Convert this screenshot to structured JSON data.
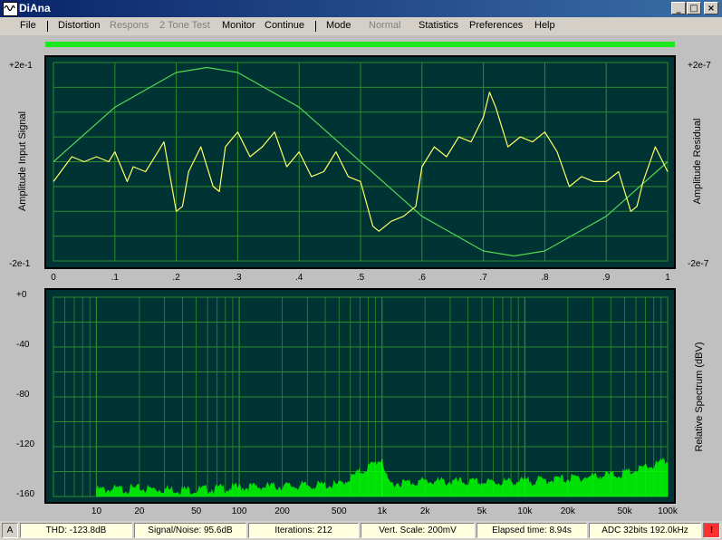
{
  "window": {
    "title": "DiAna"
  },
  "menu": [
    {
      "key": "file",
      "label": "File",
      "enabled": true
    },
    {
      "key": "distortion",
      "label": "Distortion",
      "enabled": true
    },
    {
      "key": "respons",
      "label": "Respons",
      "enabled": false
    },
    {
      "key": "two-tone-test",
      "label": "2 Tone Test",
      "enabled": false
    },
    {
      "key": "monitor",
      "label": "Monitor",
      "enabled": true
    },
    {
      "key": "continue",
      "label": "Continue",
      "enabled": true
    },
    {
      "key": "mode",
      "label": "Mode",
      "enabled": true
    },
    {
      "key": "normal",
      "label": "Normal",
      "enabled": false
    },
    {
      "key": "statistics",
      "label": "Statistics",
      "enabled": true
    },
    {
      "key": "preferences",
      "label": "Preferences",
      "enabled": true
    },
    {
      "key": "help",
      "label": "Help",
      "enabled": true
    }
  ],
  "progress": {
    "fraction": 1.0,
    "color": "#1ee81e"
  },
  "top_plot": {
    "left_axis_title": "Amplitude Input Signal",
    "right_axis_title": "Amplitude Residual",
    "left_top": "+2e-1",
    "left_bottom": "-2e-1",
    "right_top": "+2e-7",
    "right_bottom": "-2e-7",
    "x_ticks": [
      "0",
      ".1",
      ".2",
      ".3",
      ".4",
      ".5",
      ".6",
      ".7",
      ".8",
      ".9",
      "1"
    ]
  },
  "bottom_plot": {
    "right_axis_title": "Relative Spectrum  (dBV)",
    "y_ticks": [
      "+0",
      "-40",
      "-80",
      "-120",
      "-160"
    ],
    "x_ticks": [
      "10",
      "20",
      "50",
      "100",
      "200",
      "500",
      "1k",
      "2k",
      "5k",
      "10k",
      "20k",
      "50k",
      "100k"
    ]
  },
  "chart_data": [
    {
      "type": "line",
      "title": "",
      "xlabel": "",
      "ylabel": "Amplitude Input Signal",
      "xlim": [
        0,
        1
      ],
      "ylim": [
        -0.2,
        0.2
      ],
      "grid": true,
      "series": [
        {
          "name": "",
          "color": "#55d455",
          "x": [
            0,
            0.1,
            0.2,
            0.25,
            0.3,
            0.4,
            0.5,
            0.6,
            0.7,
            0.75,
            0.8,
            0.9,
            1.0
          ],
          "values": [
            0.0,
            0.11,
            0.18,
            0.19,
            0.18,
            0.11,
            0.0,
            -0.11,
            -0.18,
            -0.19,
            -0.18,
            -0.11,
            0.0
          ]
        }
      ]
    },
    {
      "type": "line",
      "title": "",
      "xlabel": "",
      "ylabel": "Amplitude Residual",
      "xlim": [
        0,
        1
      ],
      "ylim": [
        -2e-07,
        2e-07
      ],
      "grid": true,
      "series": [
        {
          "name": "",
          "color": "#ffff66",
          "x": [
            0,
            0.03,
            0.05,
            0.07,
            0.09,
            0.1,
            0.12,
            0.13,
            0.15,
            0.17,
            0.18,
            0.2,
            0.21,
            0.22,
            0.24,
            0.26,
            0.27,
            0.28,
            0.3,
            0.32,
            0.34,
            0.36,
            0.38,
            0.4,
            0.42,
            0.44,
            0.46,
            0.48,
            0.5,
            0.52,
            0.53,
            0.55,
            0.57,
            0.59,
            0.6,
            0.62,
            0.64,
            0.66,
            0.68,
            0.7,
            0.71,
            0.72,
            0.74,
            0.76,
            0.78,
            0.8,
            0.82,
            0.84,
            0.86,
            0.88,
            0.9,
            0.92,
            0.94,
            0.95,
            0.96,
            0.98,
            1.0
          ],
          "values": [
            -4e-08,
            1e-08,
            0.0,
            1e-08,
            0.0,
            2e-08,
            -4e-08,
            -1e-08,
            -2e-08,
            2e-08,
            4e-08,
            -1e-07,
            -9e-08,
            -2e-08,
            3e-08,
            -5e-08,
            -6e-08,
            3e-08,
            6e-08,
            1e-08,
            3e-08,
            6e-08,
            -1e-08,
            2e-08,
            -3e-08,
            -2e-08,
            2e-08,
            -3e-08,
            -4e-08,
            -1.3e-07,
            -1.4e-07,
            -1.2e-07,
            -1.1e-07,
            -9e-08,
            -1e-08,
            3e-08,
            1e-08,
            5e-08,
            4e-08,
            9e-08,
            1.4e-07,
            1.1e-07,
            3e-08,
            5e-08,
            4e-08,
            6e-08,
            2e-08,
            -5e-08,
            -3e-08,
            -4e-08,
            -4e-08,
            -2e-08,
            -1e-07,
            -9e-08,
            -4e-08,
            3e-08,
            -2e-08
          ]
        }
      ]
    },
    {
      "type": "line",
      "title": "",
      "xlabel": "",
      "ylabel": "Relative Spectrum  (dBV)",
      "x_scale": "log",
      "xlim": [
        5,
        100000
      ],
      "ylim": [
        -160,
        0
      ],
      "grid": true,
      "series": [
        {
          "name": "",
          "color": "#00ff00",
          "x": [
            10,
            20,
            50,
            100,
            200,
            500,
            1000,
            1100,
            2000,
            5000,
            10000,
            20000,
            50000,
            100000
          ],
          "values": [
            -155,
            -154,
            -155,
            -153,
            -152,
            -151,
            -130,
            -150,
            -148,
            -149,
            -148,
            -146,
            -142,
            -132
          ]
        }
      ]
    }
  ],
  "status": {
    "channel": "A",
    "thd": "THD: -123.8dB",
    "snr": "Signal/Noise:  95.6dB",
    "iterations": "Iterations: 212",
    "vscale": "Vert. Scale: 200mV",
    "elapsed": "Elapsed time: 8.94s",
    "adc": "ADC 32bits 192.0kHz",
    "alert": "!"
  }
}
